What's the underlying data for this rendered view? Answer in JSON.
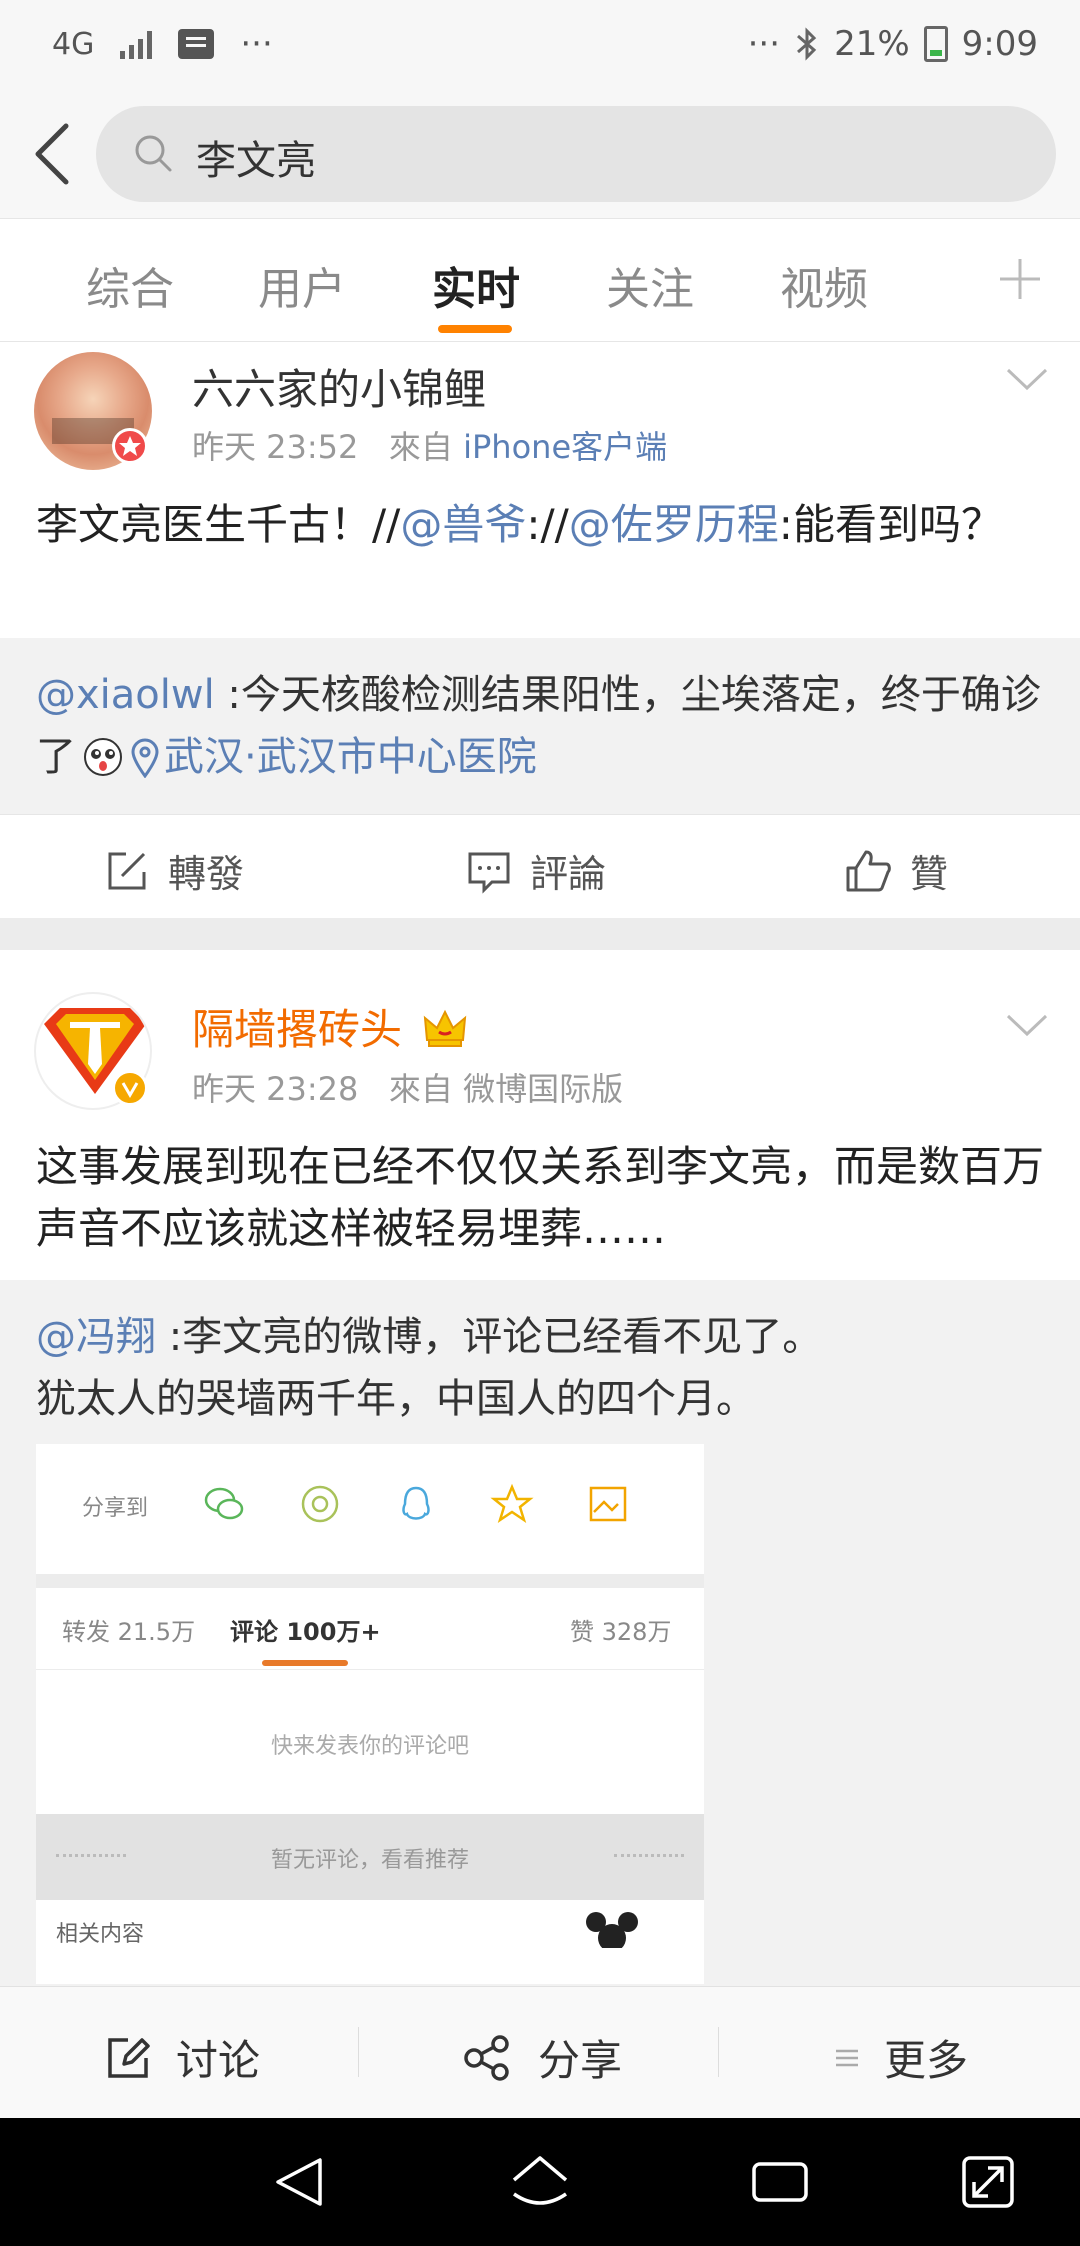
{
  "status_bar": {
    "network": "4G",
    "more": "···",
    "battery": "21%",
    "time": "9:09"
  },
  "search": {
    "query": "李文亮"
  },
  "tabs": [
    {
      "label": "综合"
    },
    {
      "label": "用户"
    },
    {
      "label": "实时"
    },
    {
      "label": "关注"
    },
    {
      "label": "视频"
    }
  ],
  "accent_color": "#ff8200",
  "link_color": "#5b7fb5",
  "posts": [
    {
      "author": "六六家的小锦鲤",
      "time": "昨天 23:52",
      "source_prefix": "來自",
      "source": "iPhone客户端",
      "text_a": "李文亮医生千古！//",
      "mention_1": "@兽爷",
      "text_b": "://",
      "mention_2": "@佐罗历程",
      "text_c": ":能看到吗？",
      "repost_user": "@xiaolwl",
      "repost_text": " :今天核酸检测结果阳性，尘埃落定，终于确诊了",
      "location": "武汉·武汉市中心医院",
      "actions": {
        "forward": "轉發",
        "comment": "評論",
        "like": "贊"
      }
    },
    {
      "author": "隔墙撂砖头",
      "time": "昨天 23:28",
      "source_prefix": "來自",
      "source": "微博国际版",
      "text": "这事发展到现在已经不仅仅关系到李文亮，而是数百万声音不应该就这样被轻易埋葬……",
      "repost_user": "@冯翔",
      "repost_text_1": " :李文亮的微博，评论已经看不见了。",
      "repost_text_2": "犹太人的哭墙两千年，中国人的四个月。",
      "embedded": {
        "share_label": "分享到",
        "forward": "转发 21.5万",
        "comment": "评论 100万+",
        "like": "赞 328万",
        "empty_prompt": "快来发表你的评论吧",
        "no_comments": "暂无评论，看看推荐",
        "related": "相关内容"
      }
    }
  ],
  "bottom_bar": {
    "discuss": "讨论",
    "share": "分享",
    "more": "更多"
  }
}
